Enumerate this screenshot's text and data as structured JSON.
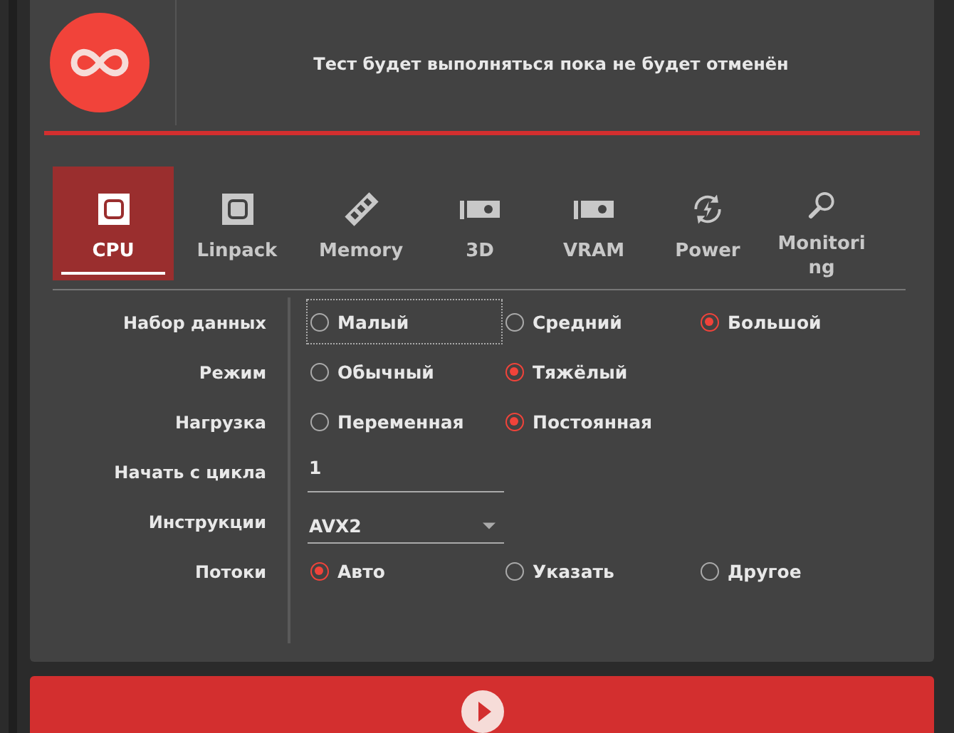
{
  "header": {
    "message": "Тест будет выполняться пока не будет отменён"
  },
  "tabs": [
    {
      "label": "CPU",
      "kind": "chip",
      "selected": true
    },
    {
      "label": "Linpack",
      "kind": "chip",
      "selected": false
    },
    {
      "label": "Memory",
      "kind": "ram",
      "selected": false
    },
    {
      "label": "3D",
      "kind": "gpu",
      "selected": false
    },
    {
      "label": "VRAM",
      "kind": "gpu",
      "selected": false
    },
    {
      "label": "Power",
      "kind": "power",
      "selected": false
    },
    {
      "label": "Monitoring",
      "kind": "search",
      "selected": false
    }
  ],
  "settings": [
    {
      "label": "Набор данных",
      "kind": "radio",
      "options": [
        {
          "label": "Малый",
          "selected": false,
          "focused": true
        },
        {
          "label": "Средний",
          "selected": false,
          "focused": false
        },
        {
          "label": "Большой",
          "selected": true,
          "focused": false
        }
      ]
    },
    {
      "label": "Режим",
      "kind": "radio",
      "options": [
        {
          "label": "Обычный",
          "selected": false,
          "focused": false
        },
        {
          "label": "Тяжёлый",
          "selected": true,
          "focused": false
        }
      ]
    },
    {
      "label": "Нагрузка",
      "kind": "radio",
      "options": [
        {
          "label": "Переменная",
          "selected": false,
          "focused": false
        },
        {
          "label": "Постоянная",
          "selected": true,
          "focused": false
        }
      ]
    },
    {
      "label": "Начать с цикла",
      "kind": "input",
      "value": "1"
    },
    {
      "label": "Инструкции",
      "kind": "select",
      "value": "AVX2"
    },
    {
      "label": "Потоки",
      "kind": "radio",
      "options": [
        {
          "label": "Авто",
          "selected": true,
          "focused": false
        },
        {
          "label": "Указать",
          "selected": false,
          "focused": false
        },
        {
          "label": "Другое",
          "selected": false,
          "focused": false
        }
      ]
    }
  ]
}
